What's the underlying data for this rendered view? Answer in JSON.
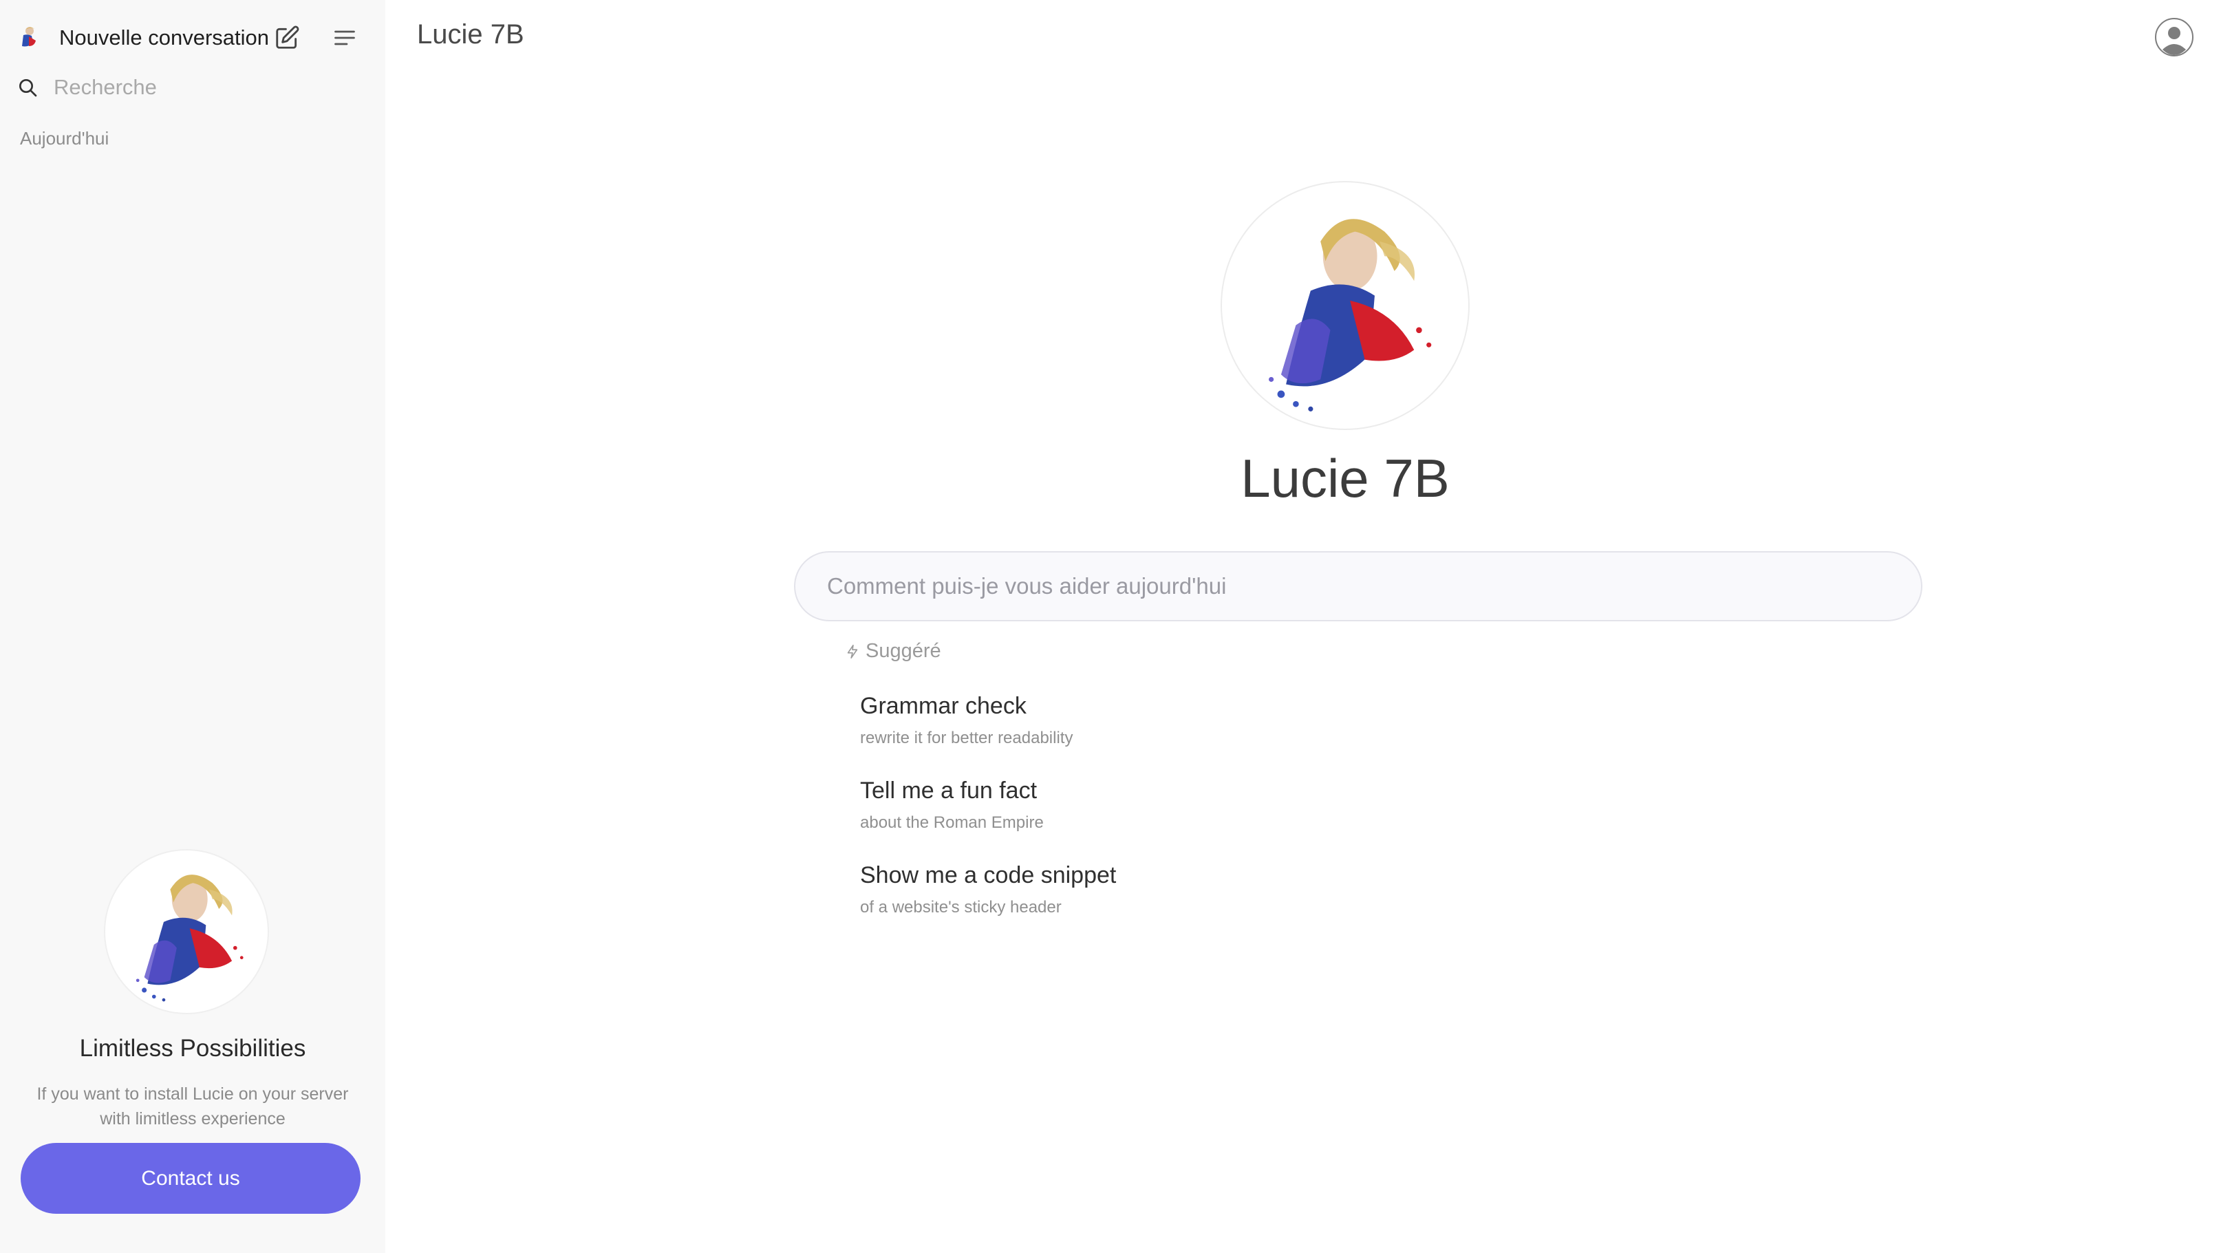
{
  "sidebar": {
    "new_chat_label": "Nouvelle conversation",
    "search_placeholder": "Recherche",
    "section_today": "Aujourd'hui",
    "promo": {
      "title": "Limitless Possibilities",
      "description": "If you want to install  Lucie on your server with limitless experience",
      "cta_label": "Contact us"
    }
  },
  "header": {
    "model_name": "Lucie 7B"
  },
  "main": {
    "hero_title": "Lucie 7B",
    "prompt_placeholder": "Comment puis-je vous aider aujourd'hui",
    "suggested_label": "Suggéré",
    "suggestions": [
      {
        "title": "Grammar check",
        "subtitle": "rewrite it for better readability"
      },
      {
        "title": "Tell me a fun fact",
        "subtitle": "about the Roman Empire"
      },
      {
        "title": "Show me a code snippet",
        "subtitle": "of a website's sticky header"
      }
    ]
  },
  "colors": {
    "accent": "#6a67e8",
    "sidebar_bg": "#f8f8f8"
  },
  "icons": [
    "lucie-logo-icon",
    "compose-icon",
    "menu-icon",
    "search-icon",
    "user-avatar-icon",
    "bolt-icon"
  ]
}
